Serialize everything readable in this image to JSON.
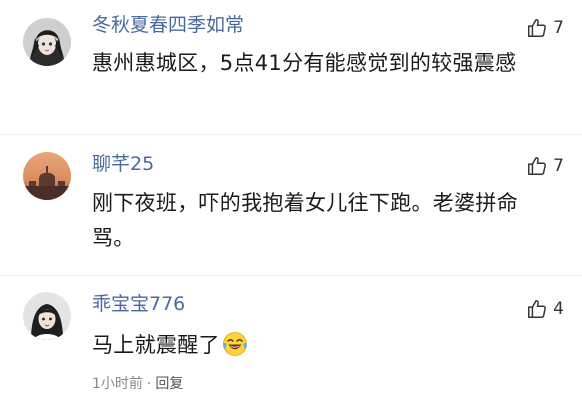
{
  "comments": [
    {
      "username": "冬秋夏春四季如常",
      "likes": "7",
      "text": "惠州惠城区，5点41分有能感觉到的较强震感",
      "avatar_icon": "anime-portrait-icon"
    },
    {
      "username": "聊芊25",
      "likes": "7",
      "text": "刚下夜班，吓的我抱着女儿往下跑。老婆拼命骂。",
      "avatar_icon": "sunset-cathedral-icon"
    },
    {
      "username": "乖宝宝776",
      "likes": "4",
      "text": "马上就震醒了",
      "avatar_icon": "girl-portrait-icon",
      "emoji": "laughing-crying-emoji-icon"
    }
  ],
  "footer": {
    "time": "1小时前",
    "separator": "·",
    "reply_label": "回复"
  },
  "colors": {
    "username": "#4a6a9c",
    "text": "#1a1a1a",
    "meta": "#8a8a8a"
  }
}
